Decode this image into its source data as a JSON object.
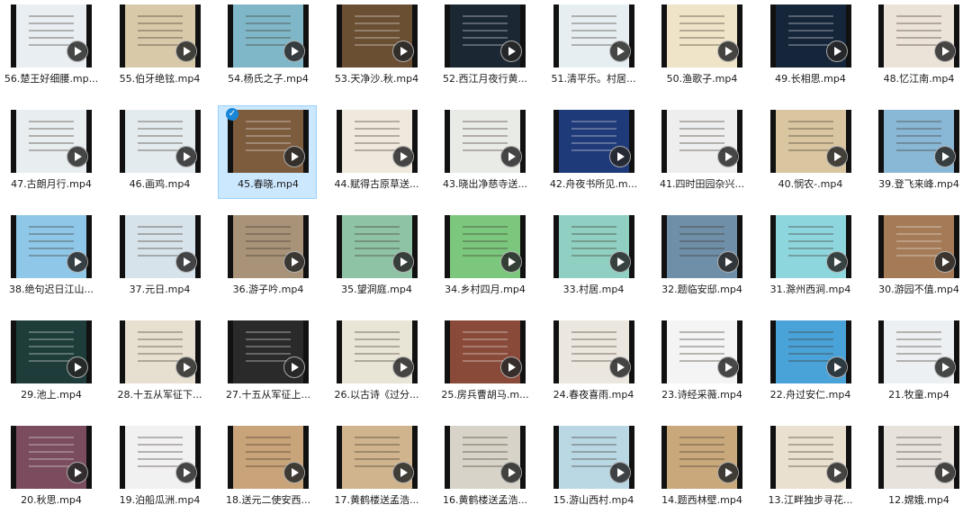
{
  "files": [
    {
      "name": "56.楚王好细腰.mp...",
      "thumb": "#e9eef2",
      "dark": false
    },
    {
      "name": "55.伯牙绝铉.mp4",
      "thumb": "#d8c9a8",
      "dark": false
    },
    {
      "name": "54.杨氏之子.mp4",
      "thumb": "#7fb7c9",
      "dark": false
    },
    {
      "name": "53.天净沙.秋.mp4",
      "thumb": "#6b4f33",
      "dark": true
    },
    {
      "name": "52.西江月夜行黄...",
      "thumb": "#1b2733",
      "dark": true
    },
    {
      "name": "51.清平乐。村居...",
      "thumb": "#e6eef2",
      "dark": false
    },
    {
      "name": "50.渔歌子.mp4",
      "thumb": "#efe3c8",
      "dark": false
    },
    {
      "name": "49.长相思.mp4",
      "thumb": "#15253a",
      "dark": true
    },
    {
      "name": "48.忆江南.mp4",
      "thumb": "#ece3d8",
      "dark": false
    },
    {
      "name": "47.古朗月行.mp4",
      "thumb": "#e8edf0",
      "dark": false
    },
    {
      "name": "46.画鸡.mp4",
      "thumb": "#e3ebef",
      "dark": false
    },
    {
      "name": "45.春晓.mp4",
      "thumb": "#7d5c3e",
      "dark": true,
      "selected": true
    },
    {
      "name": "44.赋得古原草送...",
      "thumb": "#efe8dc",
      "dark": false
    },
    {
      "name": "43.晓出净慈寺送...",
      "thumb": "#e9ebe6",
      "dark": false
    },
    {
      "name": "42.舟夜书所见.m...",
      "thumb": "#1f3a78",
      "dark": true
    },
    {
      "name": "41.四时田园杂兴...",
      "thumb": "#eeeeee",
      "dark": false
    },
    {
      "name": "40.悯农-.mp4",
      "thumb": "#d9c6a1",
      "dark": false
    },
    {
      "name": "39.登飞来峰.mp4",
      "thumb": "#89b8d6",
      "dark": false
    },
    {
      "name": "38.绝句迟日江山...",
      "thumb": "#8ec7e8",
      "dark": false
    },
    {
      "name": "37.元日.mp4",
      "thumb": "#d7e3ea",
      "dark": false
    },
    {
      "name": "36.游子吟.mp4",
      "thumb": "#a89278",
      "dark": false
    },
    {
      "name": "35.望洞庭.mp4",
      "thumb": "#8fc3a6",
      "dark": false
    },
    {
      "name": "34.乡村四月.mp4",
      "thumb": "#7cc77e",
      "dark": false
    },
    {
      "name": "33.村居.mp4",
      "thumb": "#8fd0c2",
      "dark": false
    },
    {
      "name": "32.题临安邸.mp4",
      "thumb": "#6f8fa8",
      "dark": false
    },
    {
      "name": "31.滁州西涧.mp4",
      "thumb": "#8ed6de",
      "dark": false
    },
    {
      "name": "30.游园不值.mp4",
      "thumb": "#a57b57",
      "dark": true
    },
    {
      "name": "29.池上.mp4",
      "thumb": "#1e3d3a",
      "dark": true
    },
    {
      "name": "28.十五从军征下...",
      "thumb": "#e7e0d1",
      "dark": false
    },
    {
      "name": "27.十五从军征上...",
      "thumb": "#2a2a2a",
      "dark": true
    },
    {
      "name": "26.以古诗《过分...",
      "thumb": "#e8e4d6",
      "dark": false
    },
    {
      "name": "25.房兵曹胡马.m...",
      "thumb": "#8a4a3a",
      "dark": true
    },
    {
      "name": "24.春夜喜雨.mp4",
      "thumb": "#ebe7df",
      "dark": false
    },
    {
      "name": "23.诗经采薇.mp4",
      "thumb": "#f4f4f4",
      "dark": false
    },
    {
      "name": "22.舟过安仁.mp4",
      "thumb": "#4aa3d8",
      "dark": false
    },
    {
      "name": "21.牧童.mp4",
      "thumb": "#ecf0f2",
      "dark": false
    },
    {
      "name": "20.秋思.mp4",
      "thumb": "#7a4c5e",
      "dark": true
    },
    {
      "name": "19.泊船瓜洲.mp4",
      "thumb": "#f1f1f1",
      "dark": false
    },
    {
      "name": "18.送元二使安西...",
      "thumb": "#c9a47a",
      "dark": false
    },
    {
      "name": "17.黄鹤楼送孟浩...",
      "thumb": "#cfb48d",
      "dark": false
    },
    {
      "name": "16.黄鹤楼送孟浩...",
      "thumb": "#d8d3c8",
      "dark": false
    },
    {
      "name": "15.游山西村.mp4",
      "thumb": "#b9d8e4",
      "dark": false
    },
    {
      "name": "14.题西林壁.mp4",
      "thumb": "#c9a97c",
      "dark": false
    },
    {
      "name": "13.江畔独步寻花...",
      "thumb": "#e9e0cf",
      "dark": false
    },
    {
      "name": "12.嫦娥.mp4",
      "thumb": "#e8e2dc",
      "dark": false
    }
  ]
}
